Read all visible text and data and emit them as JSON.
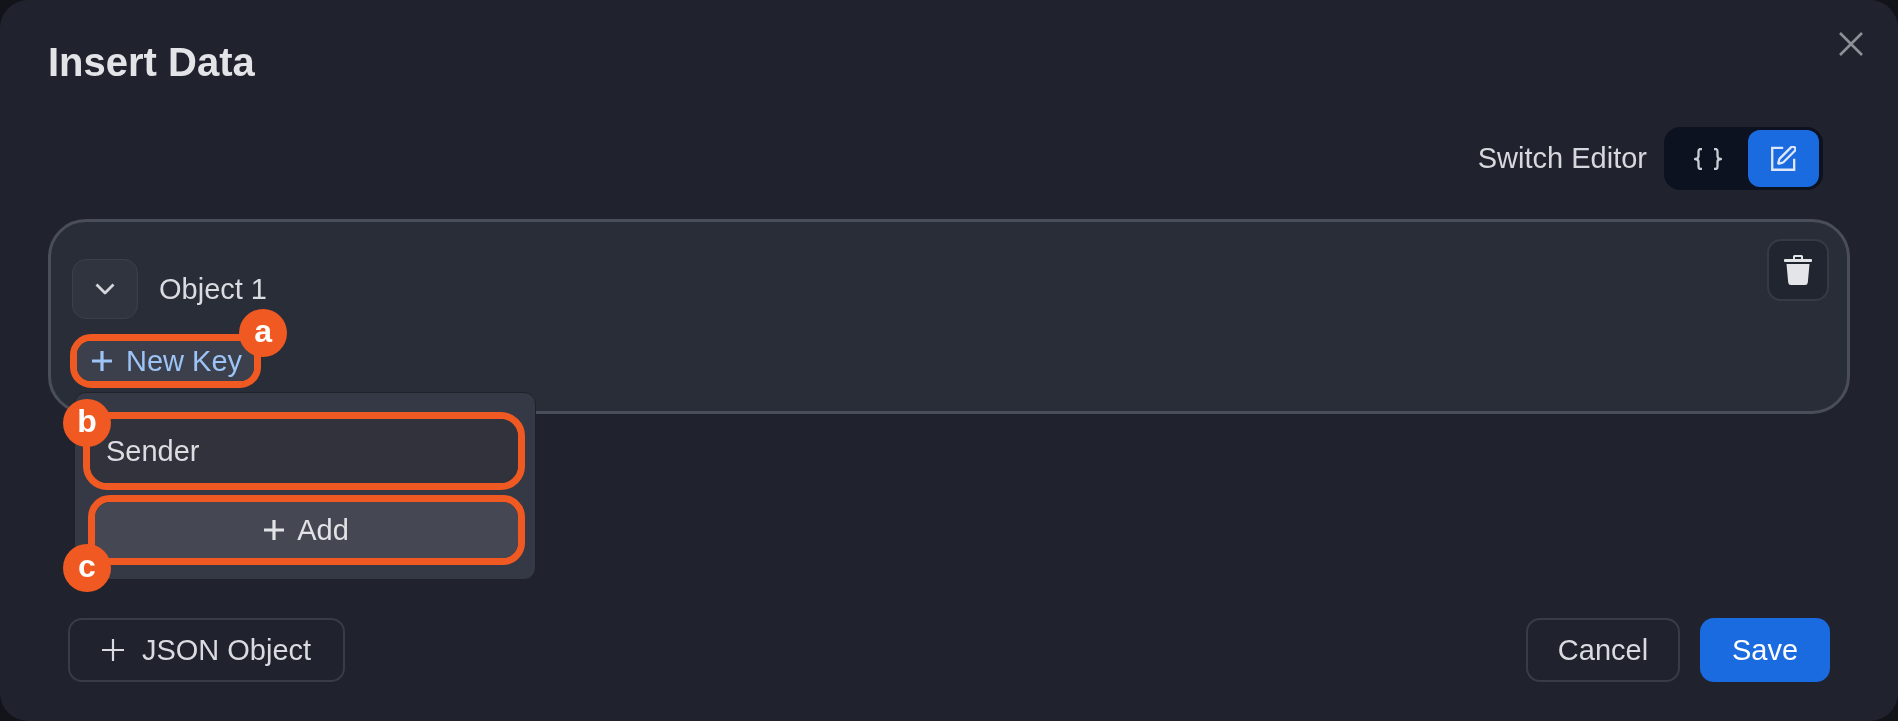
{
  "dialog": {
    "title": "Insert Data"
  },
  "editor_switch": {
    "label": "Switch Editor",
    "modes": [
      {
        "kind": "code",
        "selected": false
      },
      {
        "kind": "form",
        "selected": true
      }
    ]
  },
  "objects": [
    {
      "title": "Object 1",
      "expanded": true,
      "new_key_button": {
        "label": "New Key",
        "callout": "a"
      },
      "new_key_popover": {
        "key_field": {
          "value": "Sender",
          "callout": "b"
        },
        "add_button": {
          "label": "Add",
          "callout": "c"
        }
      }
    }
  ],
  "footer": {
    "json_object_button": "JSON Object",
    "cancel_button": "Cancel",
    "save_button": "Save"
  }
}
